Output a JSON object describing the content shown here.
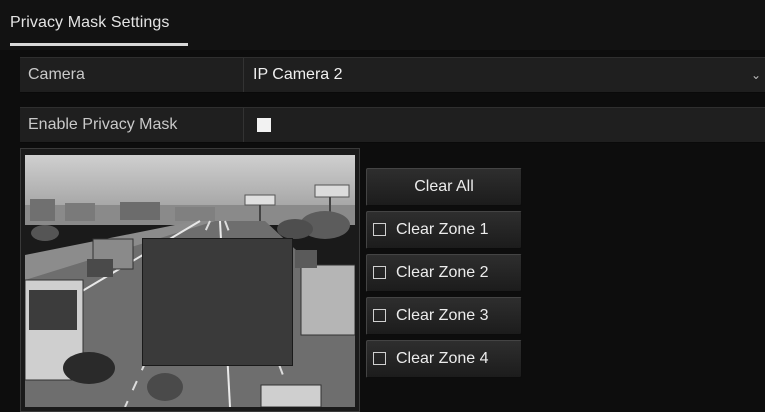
{
  "header": {
    "tab_title": "Privacy Mask Settings"
  },
  "form": {
    "camera_label": "Camera",
    "camera_value": "IP Camera 2",
    "enable_label": "Enable Privacy Mask",
    "enable_checked": true
  },
  "actions": {
    "clear_all": "Clear All",
    "zones": [
      {
        "label": "Clear Zone 1",
        "checked": false
      },
      {
        "label": "Clear Zone 2",
        "checked": false
      },
      {
        "label": "Clear Zone 3",
        "checked": false
      },
      {
        "label": "Clear Zone 4",
        "checked": false
      }
    ]
  },
  "icons": {
    "dropdown": "chevron-down-icon",
    "checkbox": "checkbox-icon"
  }
}
